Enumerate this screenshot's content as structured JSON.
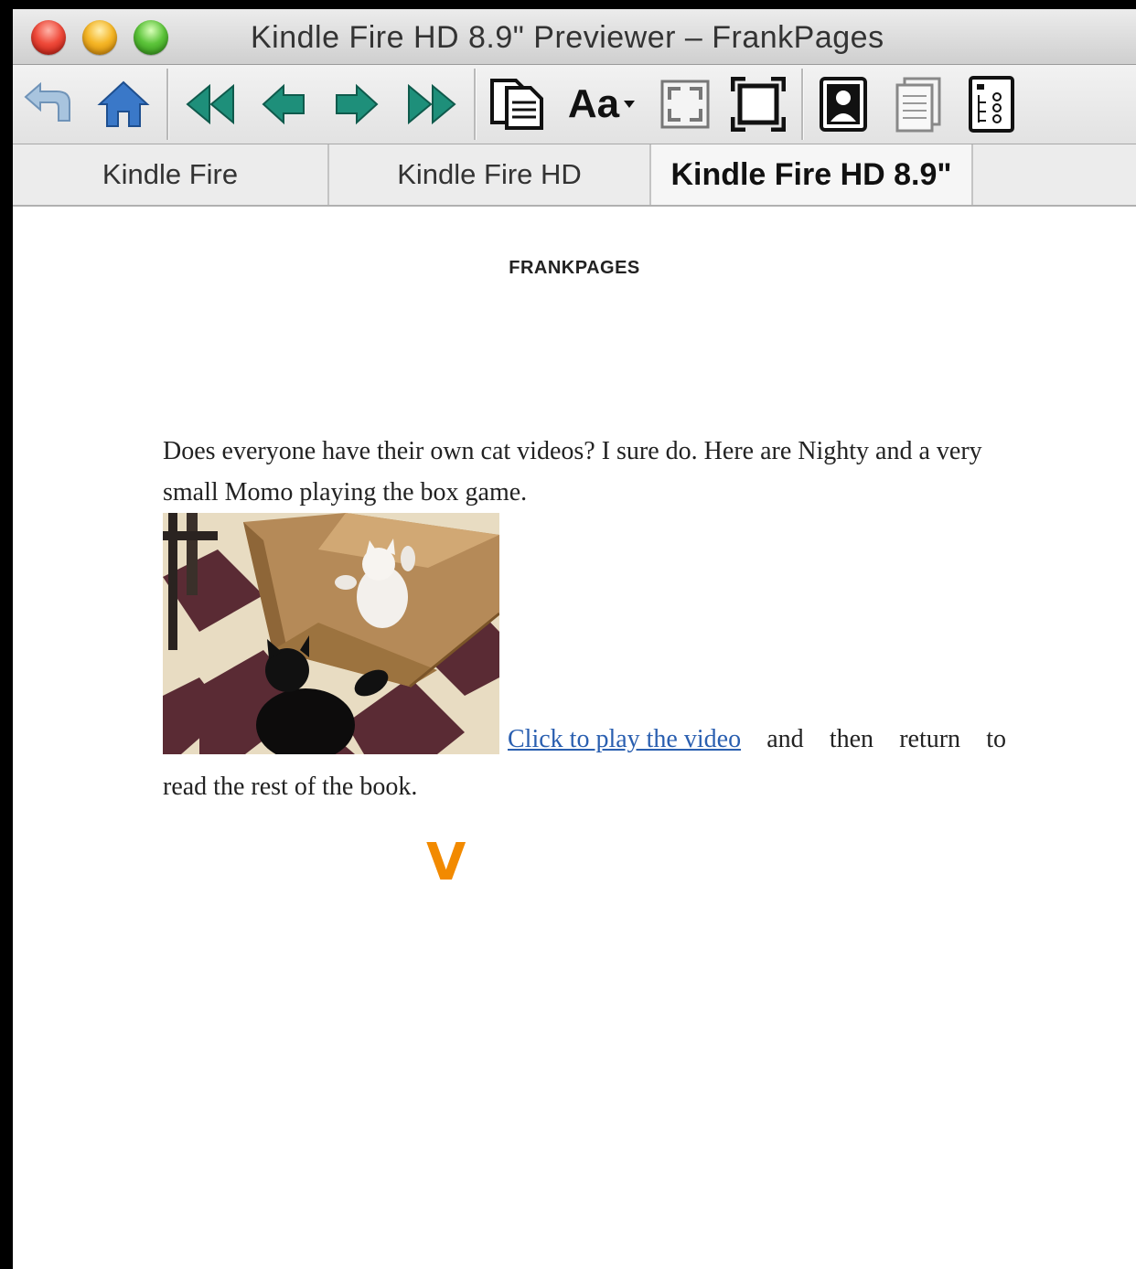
{
  "window": {
    "title": "Kindle Fire HD 8.9\" Previewer – FrankPages"
  },
  "toolbar": {
    "buttons": [
      {
        "name": "undo-button",
        "icon": "undo-icon"
      },
      {
        "name": "home-button",
        "icon": "home-icon"
      },
      {
        "name": "first-page-button",
        "icon": "double-left-arrow-icon"
      },
      {
        "name": "previous-page-button",
        "icon": "left-arrow-icon"
      },
      {
        "name": "next-page-button",
        "icon": "right-arrow-icon"
      },
      {
        "name": "last-page-button",
        "icon": "double-right-arrow-icon"
      },
      {
        "name": "book-content-button",
        "icon": "document-icon"
      },
      {
        "name": "font-size-button",
        "icon": "font-size-icon"
      },
      {
        "name": "fit-page-button",
        "icon": "fit-page-icon"
      },
      {
        "name": "full-screen-button",
        "icon": "fullscreen-icon"
      },
      {
        "name": "portrait-view-button",
        "icon": "portrait-icon"
      },
      {
        "name": "two-page-view-button",
        "icon": "two-page-icon"
      },
      {
        "name": "table-of-contents-button",
        "icon": "toc-icon"
      }
    ],
    "font_button_label": "Aa"
  },
  "tabs": [
    {
      "label": "Kindle Fire",
      "active": false
    },
    {
      "label": "Kindle Fire HD",
      "active": false
    },
    {
      "label": "Kindle Fire HD 8.9\"",
      "active": true
    }
  ],
  "page": {
    "header": "FRANKPAGES",
    "paragraph1": "Does everyone have their own cat videos? I sure do. Here are Nighty and a very small Momo playing the box game.",
    "link_text": "Click to play the video",
    "after_link_words": [
      "and",
      "then",
      "return",
      "to"
    ],
    "paragraph2": "read the rest of the book.",
    "logo_letter": "V"
  },
  "colors": {
    "link": "#2a5fb0",
    "logo": "#f28a00",
    "toolbar_icon_teal": "#1e8f7a",
    "home_icon_blue": "#3a78c8"
  }
}
